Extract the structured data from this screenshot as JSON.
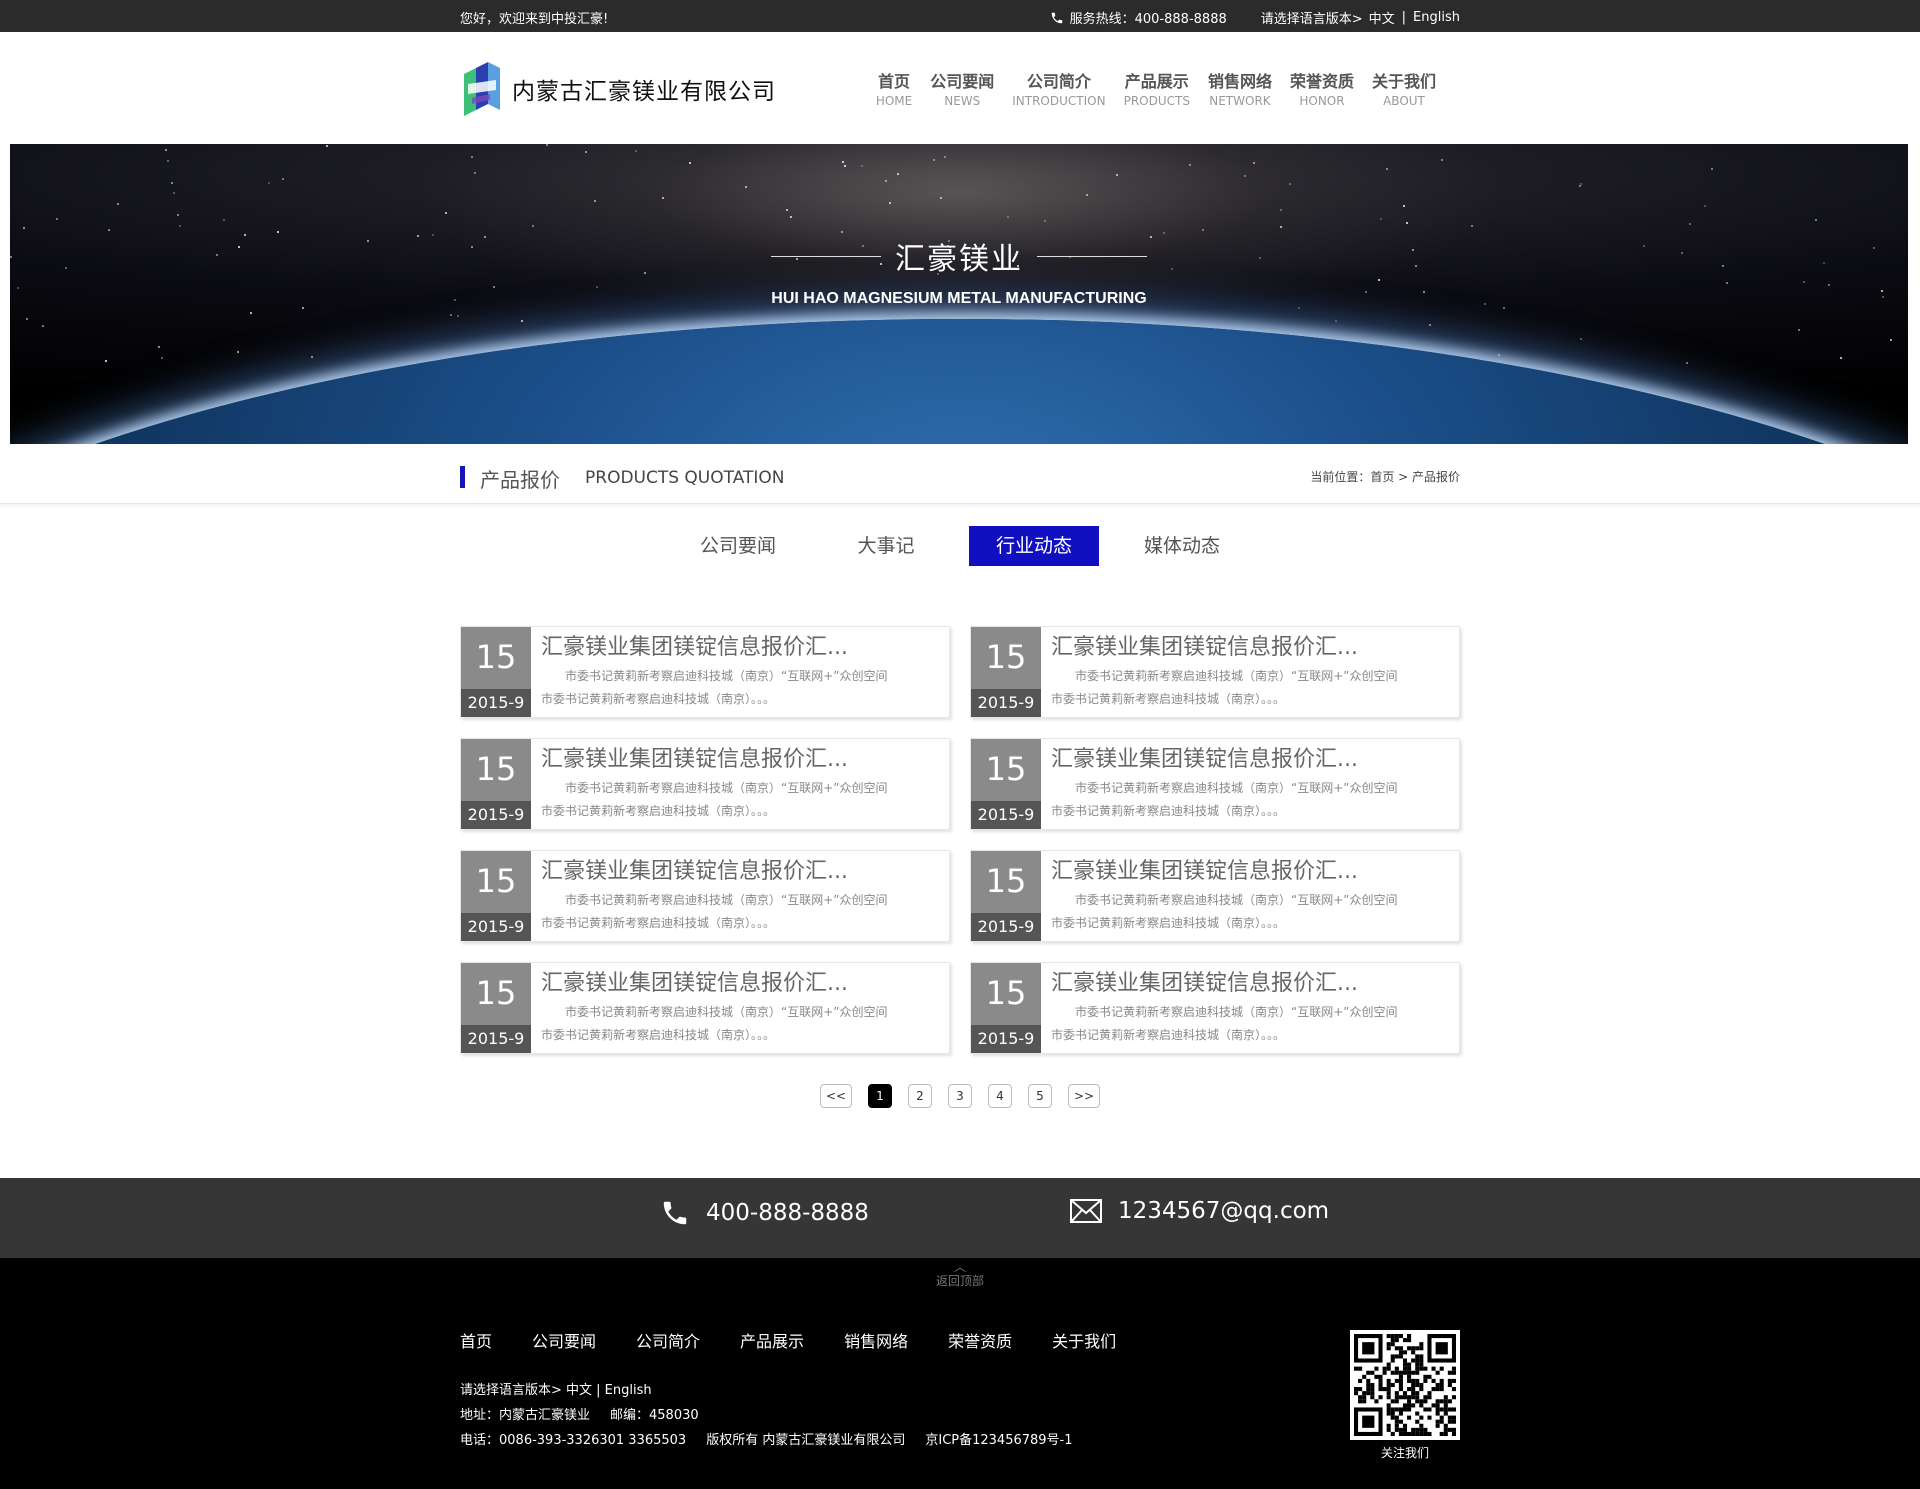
{
  "topbar": {
    "greeting": "您好，欢迎来到中投汇豪!",
    "hotline": "服务热线：400-888-8888",
    "lang_prompt": "请选择语言版本>",
    "lang_cn": "中文",
    "lang_sep": "|",
    "lang_en": "English"
  },
  "header": {
    "company_name": "内蒙古汇豪镁业有限公司",
    "nav": [
      {
        "cn": "首页",
        "en": "HOME"
      },
      {
        "cn": "公司要闻",
        "en": "NEWS"
      },
      {
        "cn": "公司简介",
        "en": "INTRODUCTION"
      },
      {
        "cn": "产品展示",
        "en": "PRODUCTS"
      },
      {
        "cn": "销售网络",
        "en": "NETWORK"
      },
      {
        "cn": "荣誉资质",
        "en": "HONOR"
      },
      {
        "cn": "关于我们",
        "en": "ABOUT"
      }
    ]
  },
  "banner": {
    "title": "汇豪镁业",
    "subtitle": "HUI HAO MAGNESIUM METAL MANUFACTURING"
  },
  "section": {
    "title_cn": "产品报价",
    "title_en": "PRODUCTS QUOTATION",
    "location": "当前位置：首页 > 产品报价"
  },
  "tabs": [
    {
      "label": "公司要闻",
      "active": false
    },
    {
      "label": "大事记",
      "active": false
    },
    {
      "label": "行业动态",
      "active": true
    },
    {
      "label": "媒体动态",
      "active": false
    }
  ],
  "news": [
    {
      "day": "15",
      "ym": "2015-9",
      "title": "汇豪镁业集团镁锭信息报价汇...",
      "line1": "市委书记黄莉新考察启迪科技城（南京）“互联网+”众创空间",
      "line2": "市委书记黄莉新考察启迪科技城（南京）。。。"
    },
    {
      "day": "15",
      "ym": "2015-9",
      "title": "汇豪镁业集团镁锭信息报价汇...",
      "line1": "市委书记黄莉新考察启迪科技城（南京）“互联网+”众创空间",
      "line2": "市委书记黄莉新考察启迪科技城（南京）。。。"
    },
    {
      "day": "15",
      "ym": "2015-9",
      "title": "汇豪镁业集团镁锭信息报价汇...",
      "line1": "市委书记黄莉新考察启迪科技城（南京）“互联网+”众创空间",
      "line2": "市委书记黄莉新考察启迪科技城（南京）。。。"
    },
    {
      "day": "15",
      "ym": "2015-9",
      "title": "汇豪镁业集团镁锭信息报价汇...",
      "line1": "市委书记黄莉新考察启迪科技城（南京）“互联网+”众创空间",
      "line2": "市委书记黄莉新考察启迪科技城（南京）。。。"
    },
    {
      "day": "15",
      "ym": "2015-9",
      "title": "汇豪镁业集团镁锭信息报价汇...",
      "line1": "市委书记黄莉新考察启迪科技城（南京）“互联网+”众创空间",
      "line2": "市委书记黄莉新考察启迪科技城（南京）。。。"
    },
    {
      "day": "15",
      "ym": "2015-9",
      "title": "汇豪镁业集团镁锭信息报价汇...",
      "line1": "市委书记黄莉新考察启迪科技城（南京）“互联网+”众创空间",
      "line2": "市委书记黄莉新考察启迪科技城（南京）。。。"
    },
    {
      "day": "15",
      "ym": "2015-9",
      "title": "汇豪镁业集团镁锭信息报价汇...",
      "line1": "市委书记黄莉新考察启迪科技城（南京）“互联网+”众创空间",
      "line2": "市委书记黄莉新考察启迪科技城（南京）。。。"
    },
    {
      "day": "15",
      "ym": "2015-9",
      "title": "汇豪镁业集团镁锭信息报价汇...",
      "line1": "市委书记黄莉新考察启迪科技城（南京）“互联网+”众创空间",
      "line2": "市委书记黄莉新考察启迪科技城（南京）。。。"
    }
  ],
  "pager": {
    "prev": "<<",
    "pages": [
      "1",
      "2",
      "3",
      "4",
      "5"
    ],
    "current": "1",
    "next": ">>"
  },
  "contact": {
    "phone": "400-888-8888",
    "email": "1234567@qq.com"
  },
  "footer": {
    "back_top": "返回顶部",
    "nav": [
      "首页",
      "公司要闻",
      "公司简介",
      "产品展示",
      "销售网络",
      "荣誉资质",
      "关于我们"
    ],
    "lang_line": "请选择语言版本> 中文 | English",
    "address": "地址：内蒙古汇豪镁业",
    "postcode": "邮编：458030",
    "phone": "电话：0086-393-3326301  3365503",
    "copyright": "版权所有 内蒙古汇豪镁业有限公司",
    "icp": "京ICP备123456789号-1",
    "qr_label": "关注我们"
  },
  "colors": {
    "accent_blue": "#1010c0",
    "topbar_bg": "#2b2b2b",
    "contact_bg": "#363636",
    "footer_bg": "#000000",
    "date_box": "#8a8a8a"
  }
}
